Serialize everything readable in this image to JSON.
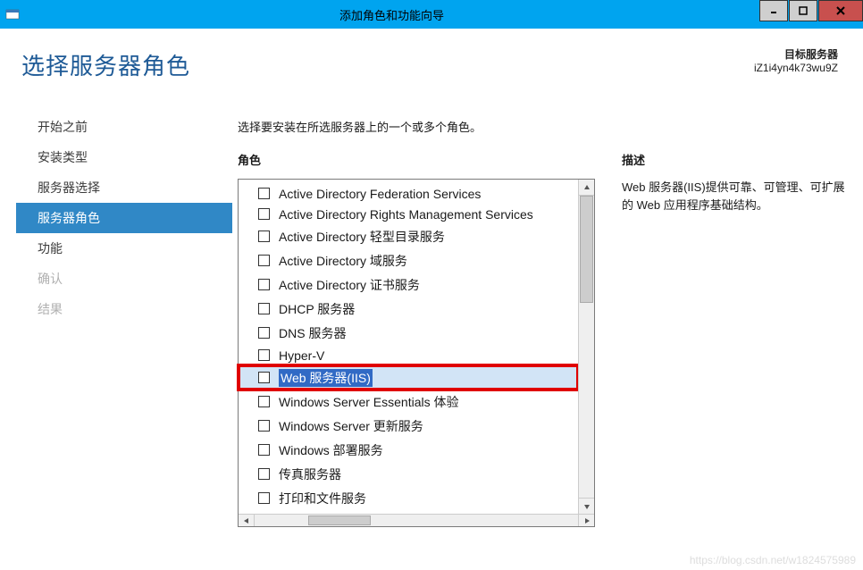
{
  "window": {
    "title": "添加角色和功能向导"
  },
  "page": {
    "heading": "选择服务器角色"
  },
  "target": {
    "label": "目标服务器",
    "name": "iZ1i4yn4k73wu9Z"
  },
  "nav": {
    "items": [
      {
        "label": "开始之前",
        "state": "normal"
      },
      {
        "label": "安装类型",
        "state": "normal"
      },
      {
        "label": "服务器选择",
        "state": "normal"
      },
      {
        "label": "服务器角色",
        "state": "selected"
      },
      {
        "label": "功能",
        "state": "normal"
      },
      {
        "label": "确认",
        "state": "disabled"
      },
      {
        "label": "结果",
        "state": "disabled"
      }
    ]
  },
  "main": {
    "instruction": "选择要安装在所选服务器上的一个或多个角色。",
    "roles_header": "角色",
    "desc_header": "描述",
    "desc_text": "Web 服务器(IIS)提供可靠、可管理、可扩展的 Web 应用程序基础结构。",
    "roles": [
      {
        "label": "Active Directory Federation Services"
      },
      {
        "label": "Active Directory Rights Management Services"
      },
      {
        "label": "Active Directory 轻型目录服务"
      },
      {
        "label": "Active Directory 域服务"
      },
      {
        "label": "Active Directory 证书服务"
      },
      {
        "label": "DHCP 服务器"
      },
      {
        "label": "DNS 服务器"
      },
      {
        "label": "Hyper-V"
      },
      {
        "label": "Web 服务器(IIS)",
        "highlight": true,
        "selected": true
      },
      {
        "label": "Windows Server Essentials 体验"
      },
      {
        "label": "Windows Server 更新服务"
      },
      {
        "label": "Windows 部署服务"
      },
      {
        "label": "传真服务器"
      },
      {
        "label": "打印和文件服务"
      }
    ]
  },
  "watermark": "https://blog.csdn.net/w1824575989"
}
